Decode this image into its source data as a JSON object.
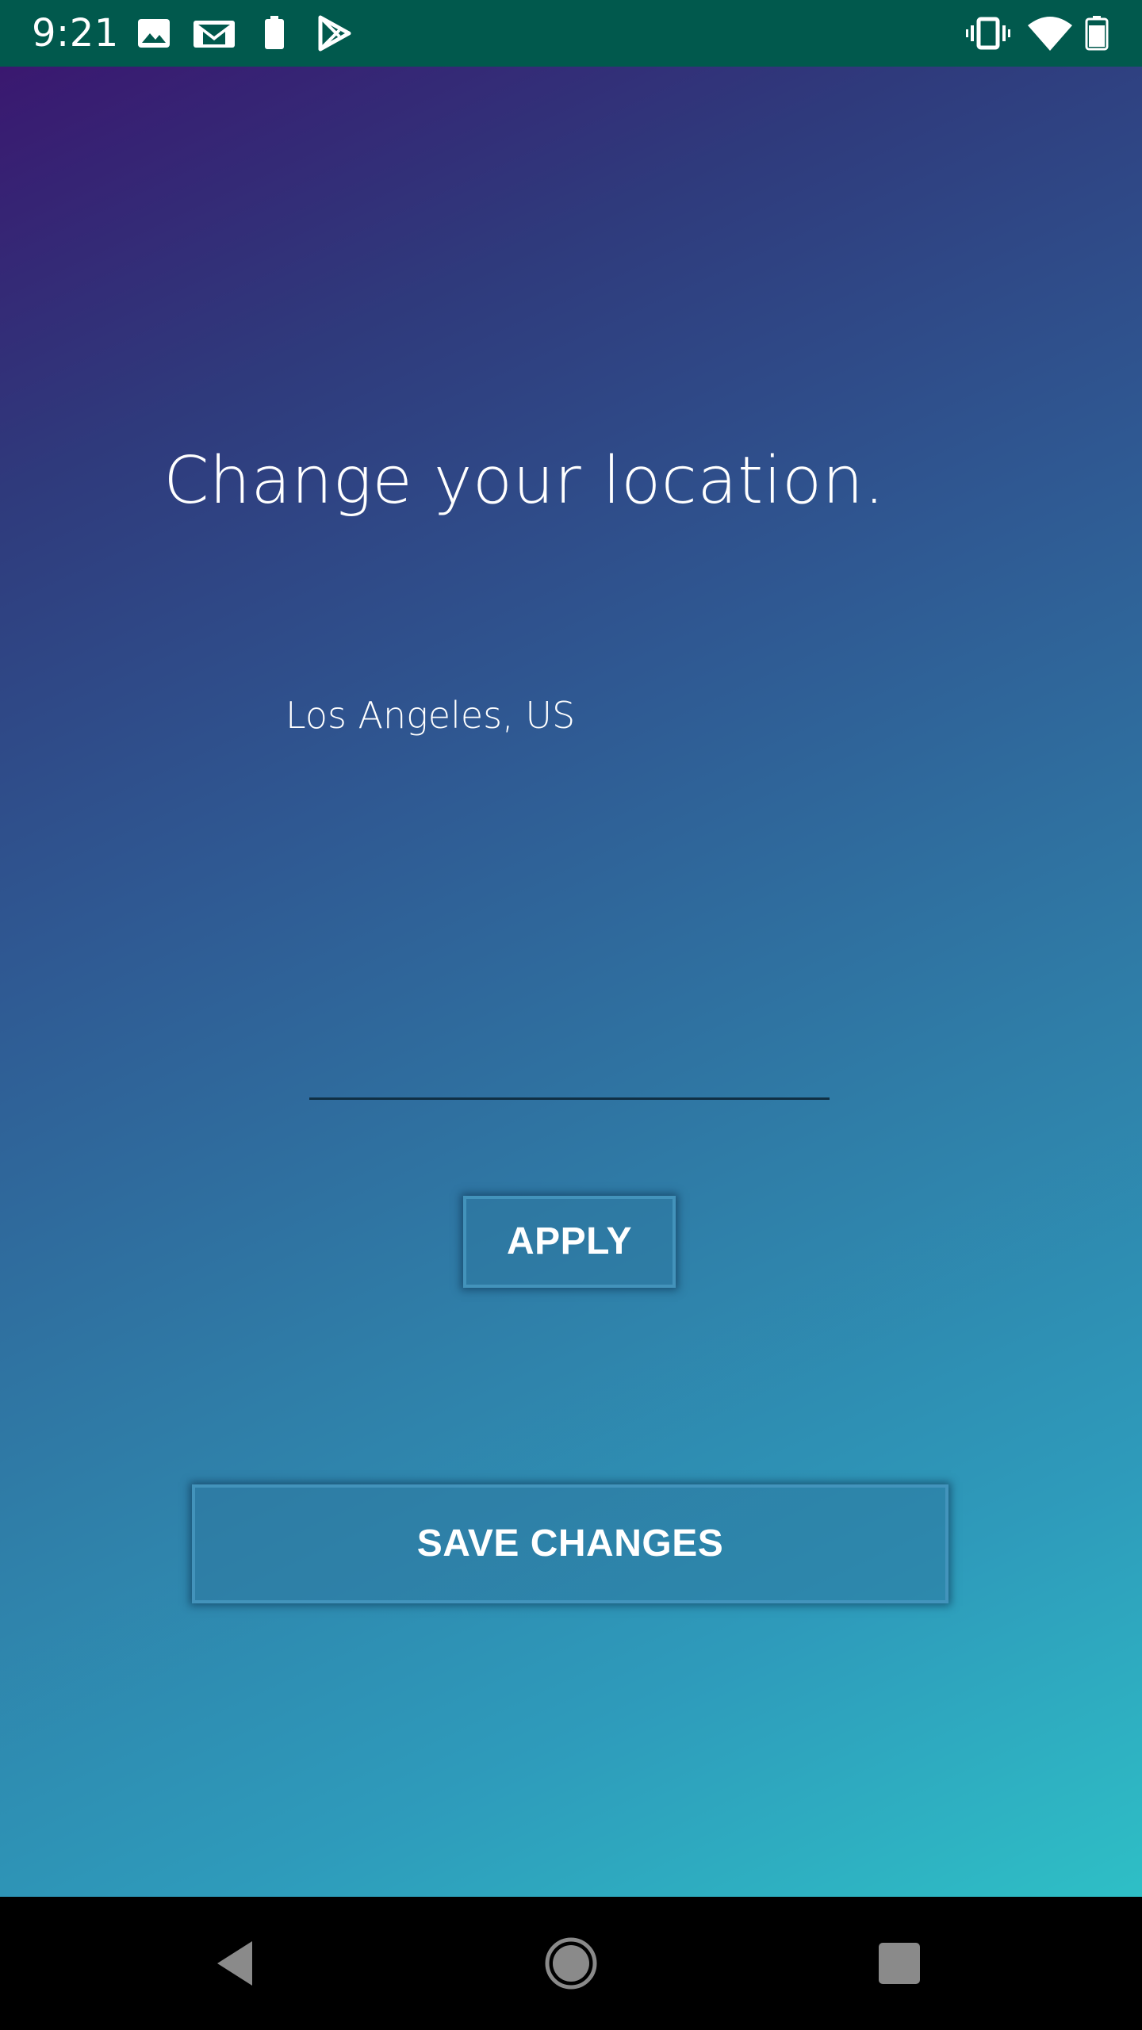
{
  "status_bar": {
    "time": "9:21",
    "background": "#01594d",
    "left_icons": [
      "image-icon",
      "gmail-icon",
      "battery-icon",
      "play-store-icon"
    ],
    "right_icons": [
      "vibrate-icon",
      "wifi-icon",
      "battery-icon"
    ]
  },
  "main": {
    "title": "Change your location.",
    "current_location": "Los Angeles, US",
    "city_input": {
      "value": "",
      "placeholder": ""
    },
    "apply_label": "APPLY",
    "save_label": "SAVE CHANGES",
    "gradient_colors": [
      "#3a1870",
      "#2f5892",
      "#2ebfc6"
    ]
  },
  "nav_bar": {
    "buttons": [
      "back-icon",
      "home-icon",
      "recents-icon"
    ]
  }
}
